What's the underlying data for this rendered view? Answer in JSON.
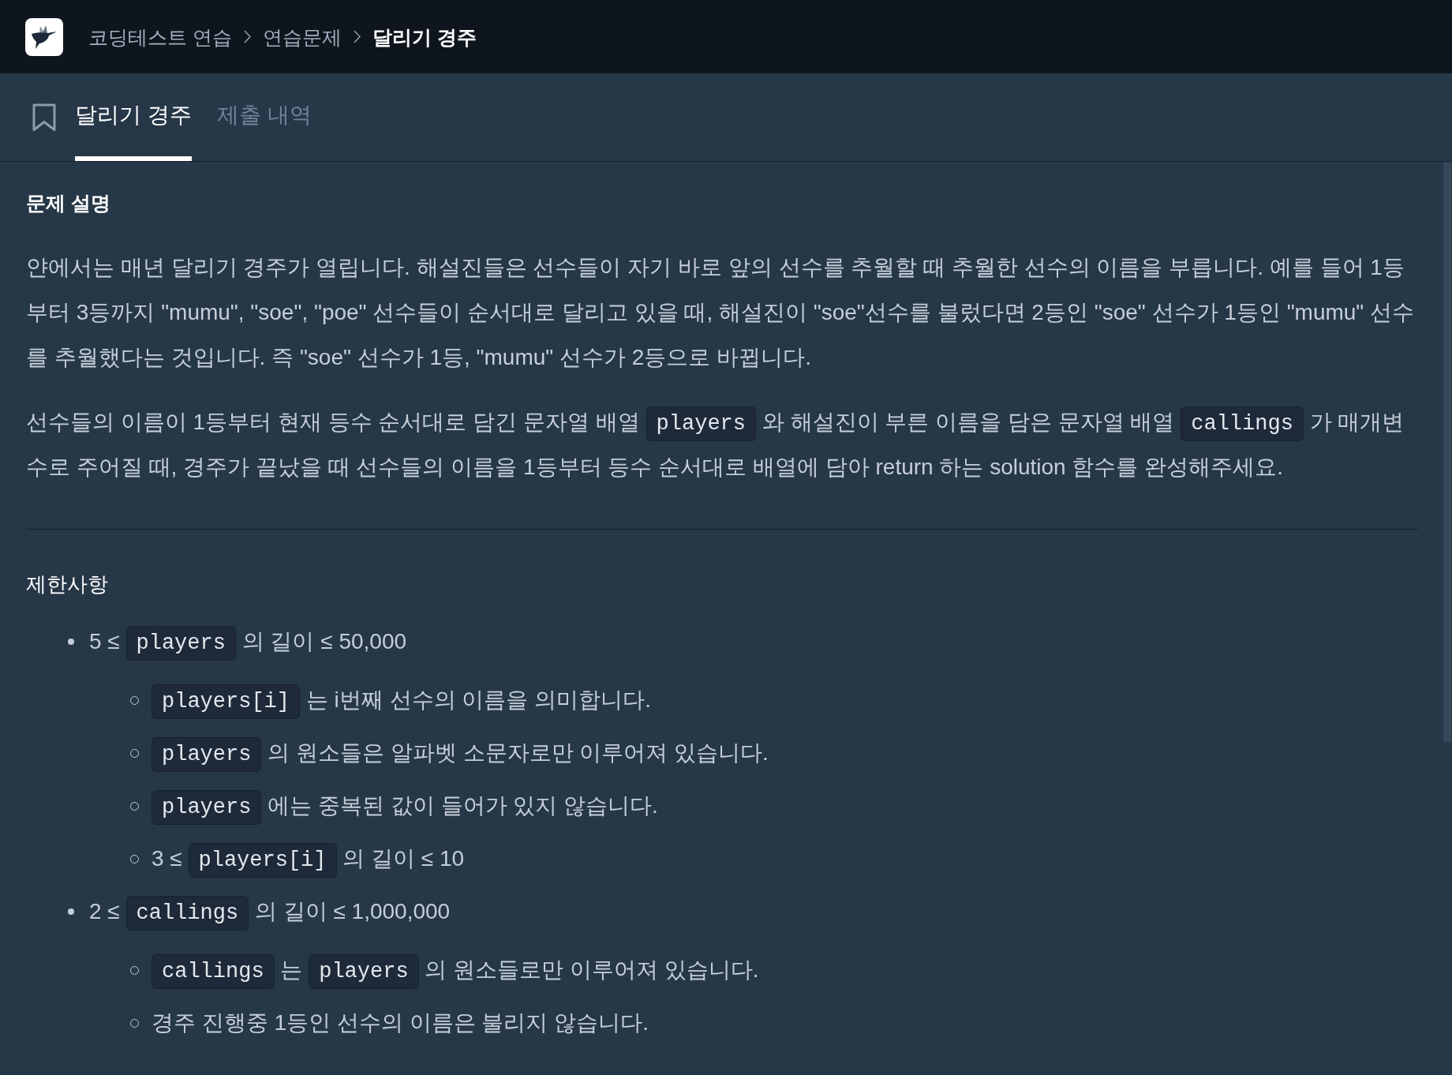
{
  "header": {
    "breadcrumb": [
      {
        "label": "코딩테스트 연습",
        "current": false
      },
      {
        "label": "연습문제",
        "current": false
      },
      {
        "label": "달리기 경주",
        "current": true
      }
    ]
  },
  "tabs": [
    {
      "label": "달리기 경주",
      "selected": true
    },
    {
      "label": "제출 내역",
      "selected": false
    }
  ],
  "description": {
    "title": "문제 설명",
    "paragraphs": [
      [
        {
          "kind": "text",
          "text": "얀에서는 매년 달리기 경주가 열립니다. 해설진들은 선수들이 자기 바로 앞의 선수를 추월할 때 추월한 선수의 이름을 부릅니다. 예를 들어 1등부터 3등까지 \"mumu\", \"soe\", \"poe\" 선수들이 순서대로 달리고 있을 때, 해설진이 \"soe\"선수를 불렀다면 2등인 \"soe\" 선수가 1등인 \"mumu\" 선수를 추월했다는 것입니다. 즉 \"soe\" 선수가 1등, \"mumu\" 선수가 2등으로 바뀝니다."
        }
      ],
      [
        {
          "kind": "text",
          "text": "선수들의 이름이 1등부터 현재 등수 순서대로 담긴 문자열 배열 "
        },
        {
          "kind": "code",
          "text": "players"
        },
        {
          "kind": "text",
          "text": " 와 해설진이 부른 이름을 담은 문자열 배열 "
        },
        {
          "kind": "code",
          "text": "callings"
        },
        {
          "kind": "text",
          "text": " 가 매개변수로 주어질 때, 경주가 끝났을 때 선수들의 이름을 1등부터 등수 순서대로 배열에 담아 return 하는 solution 함수를 완성해주세요."
        }
      ]
    ]
  },
  "constraints": {
    "title": "제한사항",
    "items": [
      {
        "segments": [
          {
            "kind": "text",
            "text": "5 ≤ "
          },
          {
            "kind": "code",
            "text": "players"
          },
          {
            "kind": "text",
            "text": " 의 길이 ≤ 50,000"
          }
        ],
        "children": [
          {
            "segments": [
              {
                "kind": "code",
                "text": "players[i]"
              },
              {
                "kind": "text",
                "text": " 는 i번째 선수의 이름을 의미합니다."
              }
            ]
          },
          {
            "segments": [
              {
                "kind": "code",
                "text": "players"
              },
              {
                "kind": "text",
                "text": " 의 원소들은 알파벳 소문자로만 이루어져 있습니다."
              }
            ]
          },
          {
            "segments": [
              {
                "kind": "code",
                "text": "players"
              },
              {
                "kind": "text",
                "text": " 에는 중복된 값이 들어가 있지 않습니다."
              }
            ]
          },
          {
            "segments": [
              {
                "kind": "text",
                "text": "3 ≤ "
              },
              {
                "kind": "code",
                "text": "players[i]"
              },
              {
                "kind": "text",
                "text": " 의 길이 ≤ 10"
              }
            ]
          }
        ]
      },
      {
        "segments": [
          {
            "kind": "text",
            "text": "2 ≤ "
          },
          {
            "kind": "code",
            "text": "callings"
          },
          {
            "kind": "text",
            "text": " 의 길이 ≤ 1,000,000"
          }
        ],
        "children": [
          {
            "segments": [
              {
                "kind": "code",
                "text": "callings"
              },
              {
                "kind": "text",
                "text": " 는 "
              },
              {
                "kind": "code",
                "text": "players"
              },
              {
                "kind": "text",
                "text": " 의 원소들로만 이루어져 있습니다."
              }
            ]
          },
          {
            "segments": [
              {
                "kind": "text",
                "text": "경주 진행중 1등인 선수의 이름은 불리지 않습니다."
              }
            ]
          }
        ]
      }
    ]
  }
}
